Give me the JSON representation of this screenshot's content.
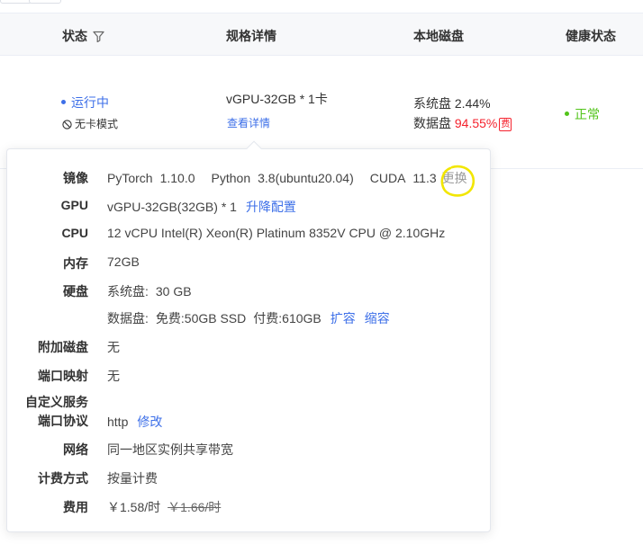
{
  "table": {
    "columns": {
      "status": "状态",
      "spec": "规格详情",
      "disk": "本地磁盘",
      "health": "健康状态"
    },
    "row": {
      "status": "运行中",
      "mode": "无卡模式",
      "spec": "vGPU-32GB * 1卡",
      "spec_link": "查看详情",
      "disk_sys_label": "系统盘",
      "disk_sys_value": "2.44%",
      "disk_data_label": "数据盘",
      "disk_data_value": "94.55%",
      "disk_data_badge": "费",
      "health": "正常"
    }
  },
  "details": {
    "image": {
      "label": "镜像",
      "framework": "PyTorch",
      "framework_ver": "1.10.0",
      "python": "Python",
      "python_ver": "3.8(ubuntu20.04)",
      "cuda": "CUDA",
      "cuda_ver": "11.3",
      "change": "更换"
    },
    "gpu": {
      "label": "GPU",
      "value": "vGPU-32GB(32GB) * 1",
      "link": "升降配置"
    },
    "cpu": {
      "label": "CPU",
      "value": "12 vCPU Intel(R) Xeon(R) Platinum 8352V CPU @ 2.10GHz"
    },
    "memory": {
      "label": "内存",
      "value": "72GB"
    },
    "disk": {
      "label": "硬盘",
      "sys_label": "系统盘:",
      "sys_value": "30 GB",
      "data_label": "数据盘:",
      "data_free": "免费:50GB SSD",
      "data_paid": "付费:610GB",
      "expand": "扩容",
      "shrink": "缩容"
    },
    "extra_disk": {
      "label": "附加磁盘",
      "value": "无"
    },
    "port_map": {
      "label": "端口映射",
      "value": "无"
    },
    "custom_service": {
      "label_line1": "自定义服务",
      "label_line2": "端口协议",
      "value": "http",
      "link": "修改"
    },
    "network": {
      "label": "网络",
      "value": "同一地区实例共享带宽"
    },
    "billing": {
      "label": "计费方式",
      "value": "按量计费"
    },
    "fee": {
      "label": "费用",
      "price": "￥1.58/时",
      "orig_price": "￥1.66/时"
    }
  },
  "colors": {
    "link": "#3d6fe8",
    "danger": "#f5222d",
    "success": "#52c41a",
    "highlight": "#f2e600"
  }
}
